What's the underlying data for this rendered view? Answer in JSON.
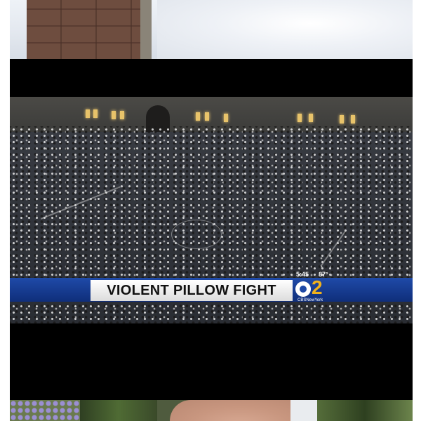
{
  "feed": {
    "cards": [
      {
        "kind": "image",
        "icon": "snow-and-stone-pillar-photo"
      },
      {
        "kind": "video",
        "icon": "pillow-fight-crowd-video-frame",
        "chyron": {
          "title": "VIOLENT PILLOW FIGHT",
          "time": "5:45",
          "temperature": "87°"
        },
        "channel_logo": {
          "number": "2",
          "subtext": "CBSNewYork",
          "accent": "#f2b21b"
        }
      },
      {
        "kind": "image",
        "icon": "person-with-flowers-photo"
      }
    ]
  },
  "colors": {
    "chyron_blue": "#1f4aa8",
    "letterbox_black": "#000000"
  }
}
